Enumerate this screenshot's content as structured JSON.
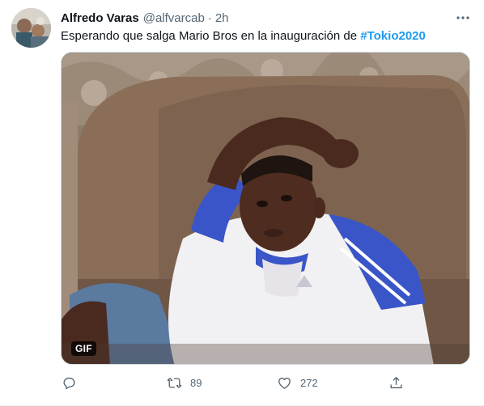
{
  "tweet": {
    "author": {
      "display_name": "Alfredo Varas",
      "handle": "@alfvarcab",
      "separator": "·",
      "time": "2h"
    },
    "text": {
      "body": "Esperando que salga Mario Bros en la inauguración de ",
      "hashtag": "#Tokio2020"
    },
    "media": {
      "type_badge": "GIF"
    },
    "actions": {
      "reply_count": "",
      "retweet_count": "89",
      "like_count": "272"
    }
  },
  "colors": {
    "accent": "#1d9bf0",
    "secondary_text": "#536471",
    "primary_text": "#0f1419"
  },
  "icons": [
    "more-icon",
    "reply-icon",
    "retweet-icon",
    "like-icon",
    "share-icon"
  ]
}
